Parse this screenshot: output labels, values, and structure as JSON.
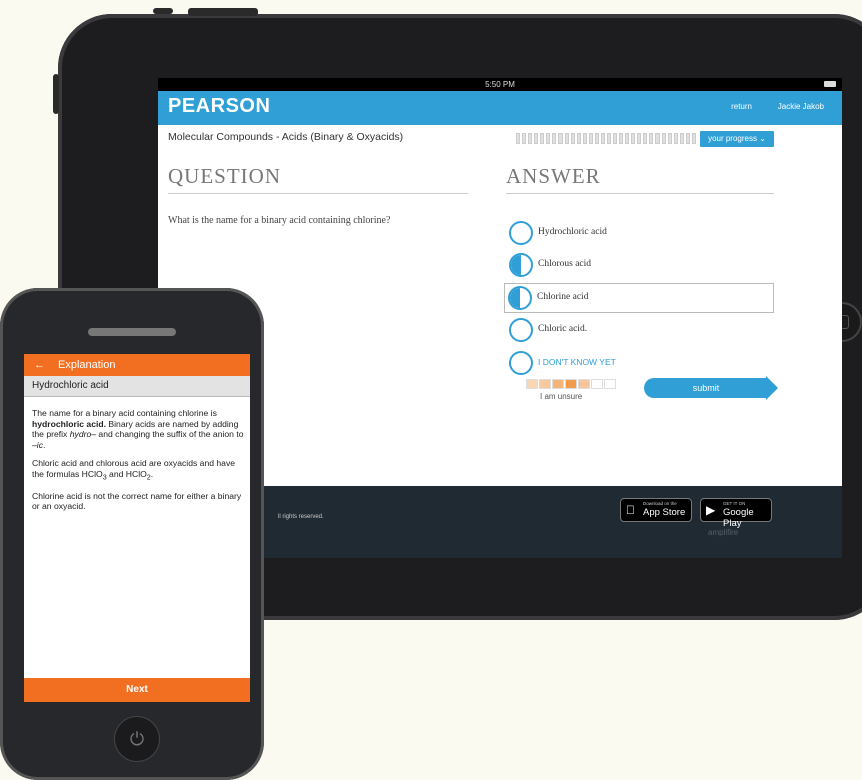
{
  "tablet": {
    "status_time": "5:50 PM",
    "header": {
      "logo": "PEARSON",
      "return_label": "return",
      "user_name": "Jackie Jakob"
    },
    "course_title": "Molecular Compounds - Acids (Binary & Oxyacids)",
    "progress_button": "your progress",
    "question_heading": "QUESTION",
    "answer_heading": "ANSWER",
    "question_text": "What is the name for a binary acid containing chlorine?",
    "answers": [
      {
        "label": "Hydrochloric acid",
        "state": "empty"
      },
      {
        "label": "Chlorous acid",
        "state": "half"
      },
      {
        "label": "Chlorine acid",
        "state": "half",
        "selected": true
      },
      {
        "label": "Chloric acid.",
        "state": "empty"
      },
      {
        "label": "I DON'T KNOW YET",
        "state": "empty"
      }
    ],
    "confidence_label": "I am unsure",
    "submit_label": "submit",
    "footer": {
      "rights": "ll rights reserved.",
      "appstore_small": "Download on the",
      "appstore_big": "App Store",
      "googleplay_small": "GET IT ON",
      "googleplay_big": "Google Play",
      "amplifire": "amplifire"
    }
  },
  "phone": {
    "header_title": "Explanation",
    "subheader": "Hydrochloric acid",
    "explanation_p1_a": "The name for a binary acid containing chlorine is ",
    "explanation_p1_bold": "hydrochloric acid.",
    "explanation_p1_b": " Binary acids are named by adding the prefix ",
    "explanation_p1_italic1": "hydro–",
    "explanation_p1_c": " and changing the suffix of the anion to ",
    "explanation_p1_italic2": "–ic",
    "explanation_p1_d": ".",
    "explanation_p2": "Chloric acid and chlorous acid are oxyacids and have the formulas HClO",
    "explanation_p2_sub1": "3",
    "explanation_p2_and": " and HClO",
    "explanation_p2_sub2": "2",
    "explanation_p2_end": ".",
    "explanation_p3": "Chlorine acid is not the correct name for either a binary or an oxyacid.",
    "next_label": "Next"
  },
  "colors": {
    "pearson_blue": "#2f9fd6",
    "orange": "#f26f21",
    "footer_dark": "#1f2a33"
  },
  "icons": [
    "back-arrow-icon",
    "apple-icon",
    "google-play-icon",
    "power-icon",
    "chevron-down-icon"
  ]
}
